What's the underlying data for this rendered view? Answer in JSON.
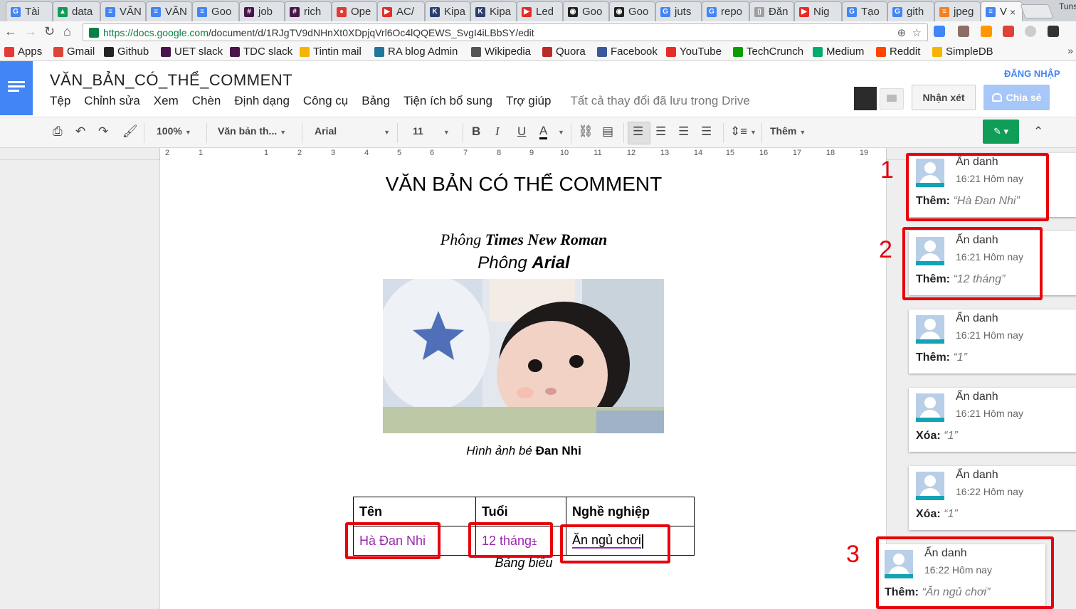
{
  "browser": {
    "tabs": [
      {
        "label": "Tài",
        "icon": "google-icon",
        "color": "#4285f4",
        "glyph": "G"
      },
      {
        "label": "data",
        "icon": "google-drive-icon",
        "color": "#0f9d58",
        "glyph": "▲"
      },
      {
        "label": "VĂN",
        "icon": "google-docs-icon",
        "color": "#4285f4",
        "glyph": "≡"
      },
      {
        "label": "VĂN",
        "icon": "google-docs-icon",
        "color": "#4285f4",
        "glyph": "≡"
      },
      {
        "label": "Goo",
        "icon": "google-docs-icon",
        "color": "#4285f4",
        "glyph": "≡"
      },
      {
        "label": "job",
        "icon": "slack-icon",
        "color": "#4a154b",
        "glyph": "#"
      },
      {
        "label": "rich",
        "icon": "slack-icon",
        "color": "#4a154b",
        "glyph": "#"
      },
      {
        "label": "Ope",
        "icon": "pokeball-icon",
        "color": "#e53935",
        "glyph": "●"
      },
      {
        "label": "AC/",
        "icon": "youtube-icon",
        "color": "#e52d27",
        "glyph": "▶"
      },
      {
        "label": "Kipa",
        "icon": "kipalog-icon",
        "color": "#2c3e70",
        "glyph": "K"
      },
      {
        "label": "Kipa",
        "icon": "kipalog-icon",
        "color": "#2c3e70",
        "glyph": "K"
      },
      {
        "label": "Led",
        "icon": "youtube-icon",
        "color": "#e52d27",
        "glyph": "▶"
      },
      {
        "label": "Goo",
        "icon": "github-icon",
        "color": "#222222",
        "glyph": "◉"
      },
      {
        "label": "Goo",
        "icon": "github-icon",
        "color": "#222222",
        "glyph": "◉"
      },
      {
        "label": "juts",
        "icon": "google-icon",
        "color": "#4285f4",
        "glyph": "G"
      },
      {
        "label": "repo",
        "icon": "google-icon",
        "color": "#4285f4",
        "glyph": "G"
      },
      {
        "label": "Đăn",
        "icon": "page-icon",
        "color": "#9e9e9e",
        "glyph": "▯"
      },
      {
        "label": "Nig",
        "icon": "youtube-icon",
        "color": "#e52d27",
        "glyph": "▶"
      },
      {
        "label": "Tạo",
        "icon": "google-icon",
        "color": "#4285f4",
        "glyph": "G"
      },
      {
        "label": "gith",
        "icon": "google-icon",
        "color": "#4285f4",
        "glyph": "G"
      },
      {
        "label": "jpeg",
        "icon": "stackoverflow-icon",
        "color": "#f48024",
        "glyph": "≡"
      },
      {
        "label": "V",
        "icon": "google-docs-icon",
        "color": "#4285f4",
        "glyph": "≡",
        "active": true
      }
    ],
    "corner_label": "Tuns",
    "url_host": "https://docs.google.com",
    "url_path": "/document/d/1RJgTV9dNHnXt0XDpjqVrl6Oc4lQQEWS_SvgI4iLBbSY/edit",
    "bookmarks": [
      {
        "label": "Apps",
        "icon": "apps-grid-icon",
        "color": "#e53935"
      },
      {
        "label": "Gmail",
        "icon": "gmail-icon",
        "color": "#db4437"
      },
      {
        "label": "Github",
        "icon": "github-icon",
        "color": "#222222"
      },
      {
        "label": "UET slack",
        "icon": "slack-icon",
        "color": "#4a154b"
      },
      {
        "label": "TDC slack",
        "icon": "slack-icon",
        "color": "#4a154b"
      },
      {
        "label": "Tintin mail",
        "icon": "mail-icon",
        "color": "#f4b400"
      },
      {
        "label": "RA blog Admin",
        "icon": "wordpress-icon",
        "color": "#21759b"
      },
      {
        "label": "Wikipedia",
        "icon": "wikipedia-icon",
        "color": "#555555"
      },
      {
        "label": "Quora",
        "icon": "quora-icon",
        "color": "#b92b27"
      },
      {
        "label": "Facebook",
        "icon": "facebook-icon",
        "color": "#3b5998"
      },
      {
        "label": "YouTube",
        "icon": "youtube-icon",
        "color": "#e52d27"
      },
      {
        "label": "TechCrunch",
        "icon": "techcrunch-icon",
        "color": "#0a9e01"
      },
      {
        "label": "Medium",
        "icon": "medium-icon",
        "color": "#00ab6c"
      },
      {
        "label": "Reddit",
        "icon": "reddit-icon",
        "color": "#ff4500"
      },
      {
        "label": "SimpleDB",
        "icon": "simpledb-icon",
        "color": "#f4b400"
      }
    ]
  },
  "docs": {
    "title": "VĂN_BẢN_CÓ_THỂ_COMMENT",
    "menu": [
      "Tệp",
      "Chỉnh sửa",
      "Xem",
      "Chèn",
      "Định dạng",
      "Công cụ",
      "Bảng",
      "Tiện ích bổ sung",
      "Trợ giúp"
    ],
    "saved_status": "Tất cả thay đổi đã lưu trong Drive",
    "signin": "ĐĂNG NHẬP",
    "comment_button": "Nhận xét",
    "share_button": "Chia sẻ",
    "accent": "#4285f4"
  },
  "toolbar": {
    "zoom": "100%",
    "style": "Văn bản th...",
    "font": "Arial",
    "size": "11",
    "more": "Thêm"
  },
  "ruler": {
    "labels": [
      "2",
      "1",
      "1",
      "2",
      "3",
      "4",
      "5",
      "6",
      "7",
      "8",
      "9",
      "10",
      "11",
      "12",
      "13",
      "14",
      "15",
      "16",
      "17",
      "18",
      "19"
    ]
  },
  "document": {
    "heading": "VĂN BẢN CÓ THỂ COMMENT",
    "times_prefix": "Phông ",
    "times_bold": "Times New Roman",
    "arial_prefix": "Phông ",
    "arial_bold": "Arial",
    "caption_prefix": "Hình ảnh bé ",
    "caption_bold": "Đan Nhi",
    "table": {
      "headers": [
        "Tên",
        "Tuổi",
        "Nghề nghiệp"
      ],
      "row": [
        "Hà Đan Nhi",
        "12 tháng",
        "Ăn ngủ chơi"
      ],
      "insert_marker": "1"
    },
    "table_caption": "Bảng biểu"
  },
  "annotations": {
    "numbers": [
      "1",
      "2",
      "3"
    ],
    "color": "#e8000c"
  },
  "comments": [
    {
      "author": "Ẩn danh",
      "time": "16:21 Hôm nay",
      "action": "Thêm:",
      "content": "“Hà Đan Nhi”"
    },
    {
      "author": "Ẩn danh",
      "time": "16:21 Hôm nay",
      "action": "Thêm:",
      "content": "“12 tháng”"
    },
    {
      "author": "Ẩn danh",
      "time": "16:21 Hôm nay",
      "action": "Thêm:",
      "content": "“1”"
    },
    {
      "author": "Ẩn danh",
      "time": "16:21 Hôm nay",
      "action": "Xóa:",
      "content": "“1”"
    },
    {
      "author": "Ẩn danh",
      "time": "16:22 Hôm nay",
      "action": "Xóa:",
      "content": "“1”"
    },
    {
      "author": "Ẩn danh",
      "time": "16:22 Hôm nay",
      "action": "Thêm:",
      "content": "“Ăn ngủ chơi”"
    }
  ]
}
